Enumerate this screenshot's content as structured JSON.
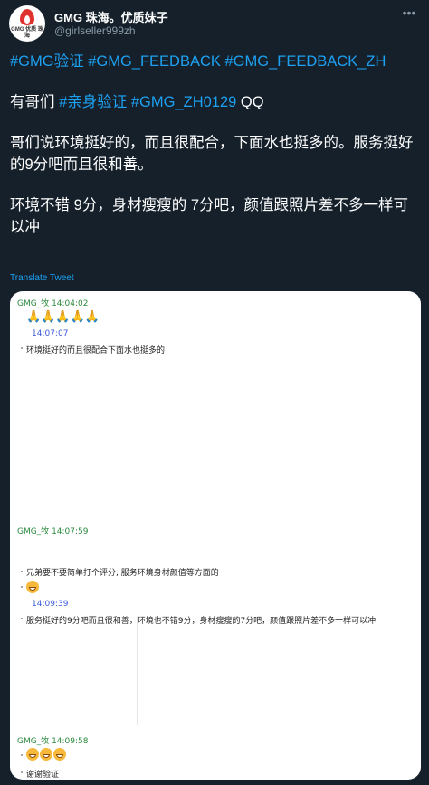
{
  "header": {
    "avatar_text": "GMG 优质\n珠海",
    "name": "GMG 珠海。优质妹子",
    "handle": "@girlseller999zh",
    "more_icon": "more-icon"
  },
  "tweet": {
    "tags_line": [
      "#GMG验证",
      "#GMG_FEEDBACK",
      "#GMG_FEEDBACK_ZH"
    ],
    "line2_prefix": "有哥们 ",
    "line2_tags": [
      "#亲身验证",
      "#GMG_ZH0129"
    ],
    "line2_suffix": " QQ",
    "para1": "哥们说环境挺好的，而且很配合，下面水也挺多的。服务挺好的9分吧而且很和善。",
    "para2": "环境不错 9分，身材瘦瘦的 7分吧，颜值跟照片差不多一样可以冲",
    "translate": "Translate Tweet"
  },
  "chat": {
    "msg1_head": "GMG_牧   14:04:02",
    "msg1_emoji": "🙏🙏🙏🙏🙏",
    "msg1_time": "14:07:07",
    "msg1_text": "环境挺好的而且很配合下面水也挺多的",
    "msg2_head": "GMG_牧   14:07:59",
    "msg2_text": "兄弟要不要简单打个评分, 服务环境身材颜值等方面的",
    "msg2_time": "14:09:39",
    "msg2_text2": "服务挺好的9分吧而且很和善，环境也不错9分，身材瘦瘦的7分吧，颜值跟照片差不多一样可以冲",
    "msg3_head": "GMG_牧   14:09:58",
    "msg3_text": "谢谢验证"
  },
  "colors": {
    "background": "#15202b",
    "link": "#1da1f2",
    "secondary": "#8899a6"
  }
}
